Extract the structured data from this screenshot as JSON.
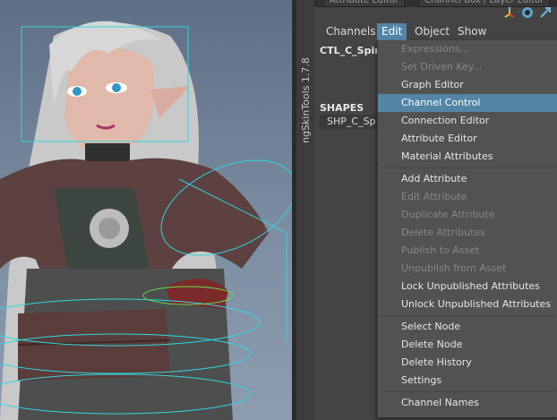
{
  "ngskin_tab": {
    "label": "ngSkinTools 1.7.8"
  },
  "top_tabs": [
    "Attribute Editor",
    "Channel Box / Layer Editor"
  ],
  "menu_bar": [
    "Channels",
    "Edit",
    "Object",
    "Show"
  ],
  "channel_box": {
    "object_name": "CTL_C_Spin",
    "shapes_label": "SHAPES",
    "shape_name": "SHP_C_Sp"
  },
  "edit_menu": {
    "items": [
      {
        "label": "Expressions...",
        "enabled": false
      },
      {
        "label": "Set Driven Key...",
        "enabled": false
      },
      {
        "label": "Graph Editor",
        "enabled": true
      },
      {
        "label": "Channel Control",
        "enabled": true,
        "highlighted": true
      },
      {
        "label": "Connection Editor",
        "enabled": true
      },
      {
        "label": "Attribute Editor",
        "enabled": true
      },
      {
        "label": "Material Attributes",
        "enabled": true
      },
      {
        "label": "Add Attribute",
        "enabled": true
      },
      {
        "label": "Edit Attribute",
        "enabled": false
      },
      {
        "label": "Duplicate Attribute",
        "enabled": false
      },
      {
        "label": "Delete Attributes",
        "enabled": false
      },
      {
        "label": "Publish to Asset",
        "enabled": false
      },
      {
        "label": "Unpublish from Asset",
        "enabled": false
      },
      {
        "label": "Lock Unpublished Attributes",
        "enabled": true
      },
      {
        "label": "Unlock Unpublished Attributes",
        "enabled": true
      },
      {
        "label": "Select Node",
        "enabled": true
      },
      {
        "label": "Delete Node",
        "enabled": true
      },
      {
        "label": "Delete History",
        "enabled": true
      },
      {
        "label": "Settings",
        "enabled": true
      },
      {
        "label": "Channel Names",
        "enabled": true
      }
    ]
  },
  "colors": {
    "highlight": "#5285a6",
    "panel": "#444444",
    "menu": "#525252"
  }
}
